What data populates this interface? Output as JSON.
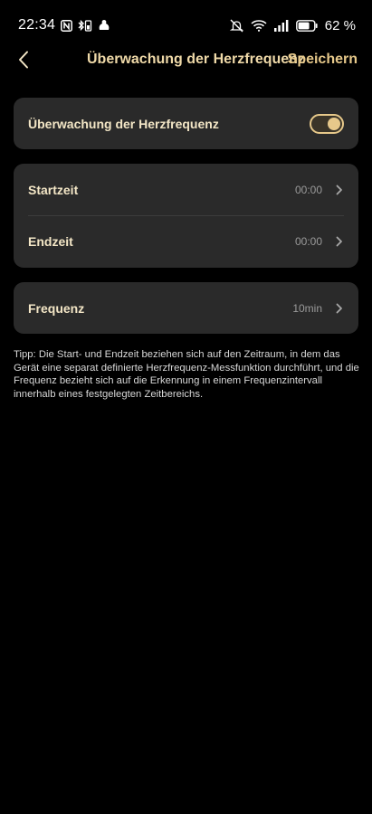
{
  "status_bar": {
    "time": "22:34",
    "battery": "62 %",
    "icons": [
      "nfc-icon",
      "bluetooth-battery-icon",
      "app-notification-icon",
      "mute-icon",
      "wifi-icon",
      "signal-icon",
      "battery-icon"
    ]
  },
  "header": {
    "title": "Überwachung der Herzfrequenz",
    "save_label": "Speichern"
  },
  "monitoring": {
    "label": "Überwachung der Herzfrequenz",
    "enabled": true
  },
  "times": {
    "start_label": "Startzeit",
    "start_value": "00:00",
    "end_label": "Endzeit",
    "end_value": "00:00"
  },
  "frequency": {
    "label": "Frequenz",
    "value": "10min"
  },
  "tip": "Tipp: Die Start- und Endzeit beziehen sich auf den Zeitraum, in dem das Gerät eine separat definierte Herzfrequenz-Messfunktion durchführt, und die Frequenz bezieht sich auf die Erkennung in einem Frequenzintervall innerhalb eines festgelegten Zeitbereichs.",
  "colors": {
    "background": "#000000",
    "card": "#2a2a2a",
    "accent": "#e6c88a",
    "label": "#f3e6c6",
    "value": "#9a9a9a"
  }
}
